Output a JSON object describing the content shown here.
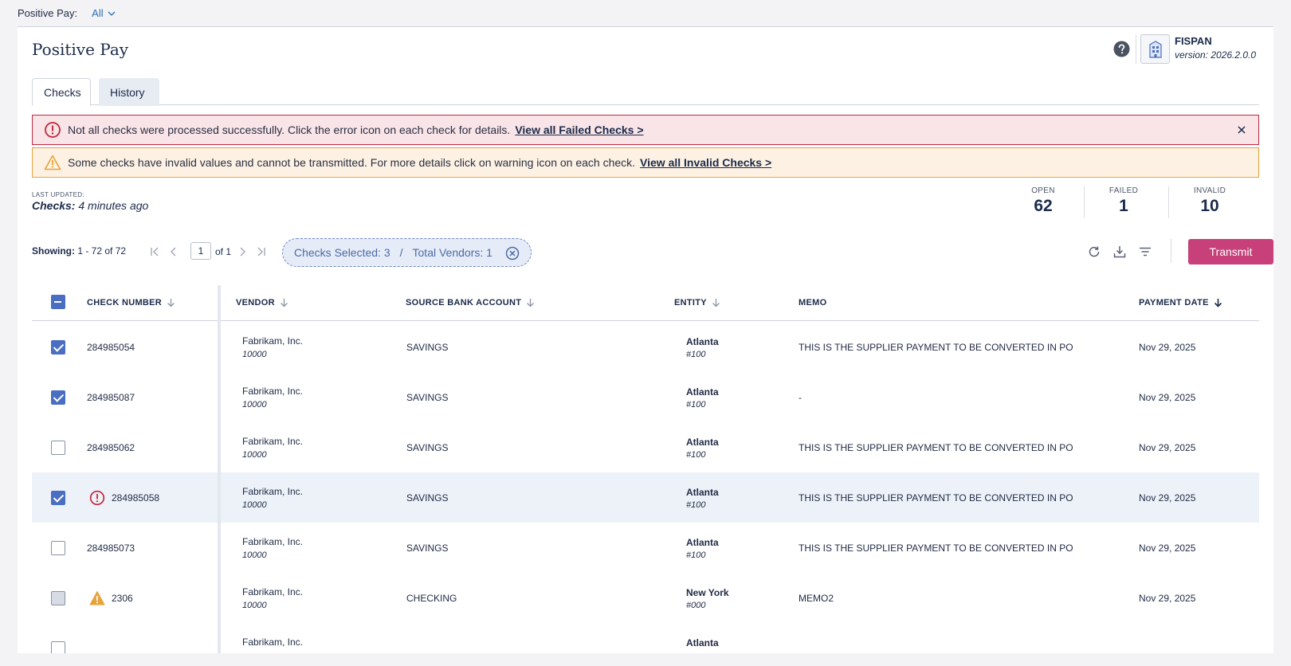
{
  "filter": {
    "label": "Positive Pay:",
    "value": "All"
  },
  "page": {
    "title": "Positive Pay"
  },
  "brand": {
    "name": "FISPAN",
    "version": "version: 2026.2.0.0"
  },
  "tabs": [
    {
      "label": "Checks"
    },
    {
      "label": "History"
    }
  ],
  "alerts": {
    "error": {
      "message": "Not all checks were processed successfully. Click the error icon on each check for details.",
      "link": "View all Failed Checks >"
    },
    "warning": {
      "message": "Some checks have invalid values and cannot be transmitted. For more details click on warning icon on each check.",
      "link": "View all Invalid Checks >"
    }
  },
  "last_updated": {
    "label": "LAST UPDATED:",
    "prefix": "Checks:",
    "value": "4 minutes ago"
  },
  "stats": [
    {
      "label": "OPEN",
      "value": "62"
    },
    {
      "label": "FAILED",
      "value": "1"
    },
    {
      "label": "INVALID",
      "value": "10"
    }
  ],
  "pagination": {
    "showing_label": "Showing:",
    "showing_value": "1 - 72 of 72",
    "page": "1",
    "of": "of 1"
  },
  "selection": {
    "checks": "Checks Selected: 3",
    "separator": "/",
    "vendors": "Total Vendors: 1"
  },
  "actions": {
    "transmit": "Transmit"
  },
  "colors": {
    "accent": "#c7407a",
    "error": "#c1283f",
    "warning": "#e8a23a",
    "checkbox": "#4a6ec1"
  },
  "columns": [
    "CHECK NUMBER",
    "VENDOR",
    "SOURCE BANK ACCOUNT",
    "ENTITY",
    "MEMO",
    "PAYMENT DATE"
  ],
  "rows": [
    {
      "checked": "checked",
      "status": "",
      "check": "284985054",
      "vendor": "Fabrikam, Inc.",
      "vendor_id": "10000",
      "account": "SAVINGS",
      "entity": "Atlanta",
      "entity_id": "#100",
      "memo": "THIS IS THE SUPPLIER PAYMENT TO BE CONVERTED IN PO",
      "date": "Nov 29, 2025"
    },
    {
      "checked": "checked",
      "status": "",
      "check": "284985087",
      "vendor": "Fabrikam, Inc.",
      "vendor_id": "10000",
      "account": "SAVINGS",
      "entity": "Atlanta",
      "entity_id": "#100",
      "memo": "-",
      "date": "Nov 29, 2025"
    },
    {
      "checked": "unchecked",
      "status": "",
      "check": "284985062",
      "vendor": "Fabrikam, Inc.",
      "vendor_id": "10000",
      "account": "SAVINGS",
      "entity": "Atlanta",
      "entity_id": "#100",
      "memo": "THIS IS THE SUPPLIER PAYMENT TO BE CONVERTED IN PO",
      "date": "Nov 29, 2025"
    },
    {
      "checked": "checked",
      "status": "error",
      "check": "284985058",
      "vendor": "Fabrikam, Inc.",
      "vendor_id": "10000",
      "account": "SAVINGS",
      "entity": "Atlanta",
      "entity_id": "#100",
      "memo": "THIS IS THE SUPPLIER PAYMENT TO BE CONVERTED IN PO",
      "date": "Nov 29, 2025"
    },
    {
      "checked": "unchecked",
      "status": "",
      "check": "284985073",
      "vendor": "Fabrikam, Inc.",
      "vendor_id": "10000",
      "account": "SAVINGS",
      "entity": "Atlanta",
      "entity_id": "#100",
      "memo": "THIS IS THE SUPPLIER PAYMENT TO BE CONVERTED IN PO",
      "date": "Nov 29, 2025"
    },
    {
      "checked": "disabled",
      "status": "warning",
      "check": "2306",
      "vendor": "Fabrikam, Inc.",
      "vendor_id": "10000",
      "account": "CHECKING",
      "entity": "New York",
      "entity_id": "#000",
      "memo": "MEMO2",
      "date": "Nov 29, 2025"
    },
    {
      "checked": "unchecked",
      "status": "",
      "check": "",
      "vendor": "Fabrikam, Inc.",
      "vendor_id": "",
      "account": "",
      "entity": "Atlanta",
      "entity_id": "",
      "memo": "",
      "date": ""
    }
  ]
}
